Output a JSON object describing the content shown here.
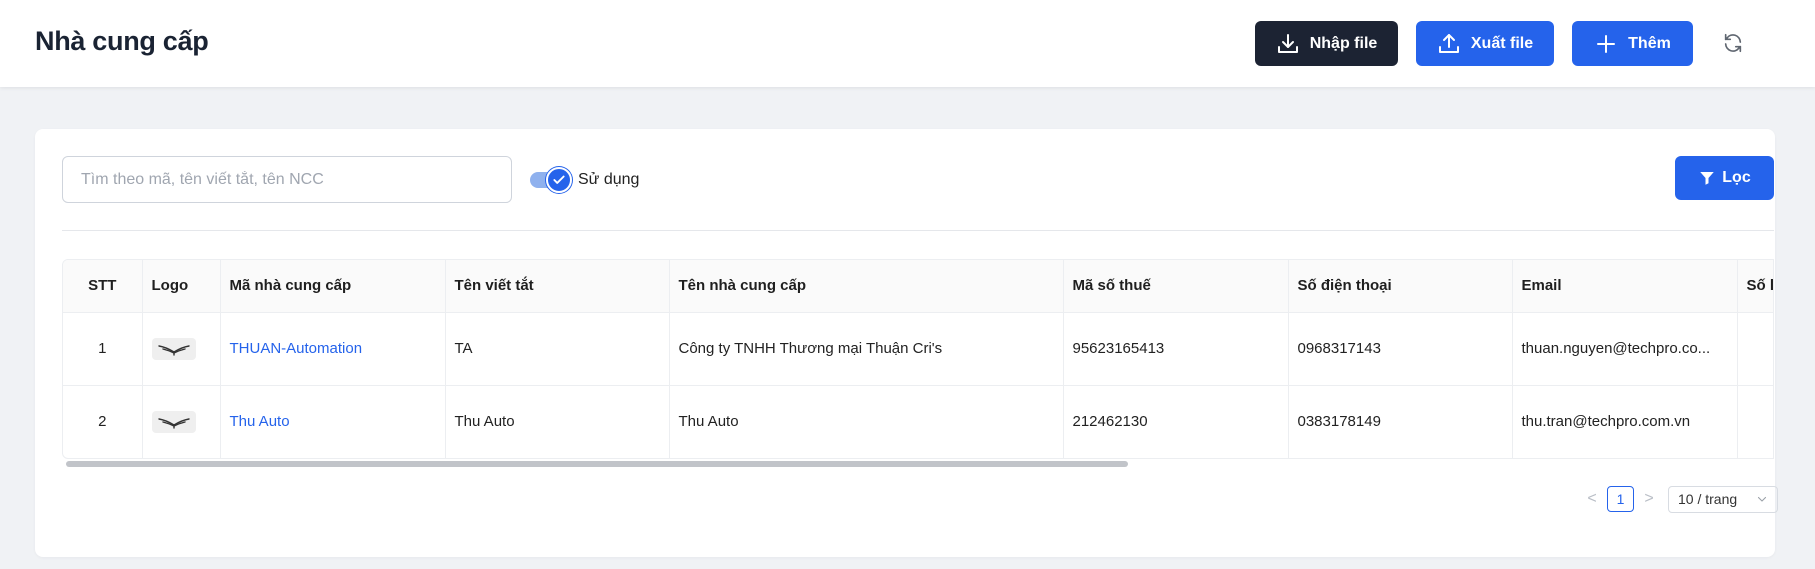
{
  "header": {
    "title": "Nhà cung cấp",
    "import_label": "Nhập file",
    "export_label": "Xuất file",
    "add_label": "Thêm"
  },
  "toolbar": {
    "search_placeholder": "Tìm theo mã, tên viết tắt, tên NCC",
    "search_value": "",
    "toggle_label": "Sử dụng",
    "toggle_on": true,
    "filter_label": "Lọc"
  },
  "table": {
    "columns": [
      "STT",
      "Logo",
      "Mã nhà cung cấp",
      "Tên viết tắt",
      "Tên nhà cung cấp",
      "Mã số thuế",
      "Số điện thoại",
      "Email",
      "Số l"
    ],
    "rows": [
      {
        "stt": "1",
        "code": "THUAN-Automation",
        "short_name": "TA",
        "name": "Công ty TNHH Thương mại Thuận Cri's",
        "tax_code": "95623165413",
        "phone": "0968317143",
        "email": "thuan.nguyen@techpro.co..."
      },
      {
        "stt": "2",
        "code": "Thu Auto",
        "short_name": "Thu Auto",
        "name": "Thu Auto",
        "tax_code": "212462130",
        "phone": "0383178149",
        "email": "thu.tran@techpro.com.vn"
      }
    ]
  },
  "pagination": {
    "prev": "<",
    "current_page": "1",
    "next": ">",
    "page_size_label": "10 / trang"
  },
  "colors": {
    "primary": "#2563eb",
    "dark": "#1c2333",
    "background": "#f0f2f5"
  }
}
